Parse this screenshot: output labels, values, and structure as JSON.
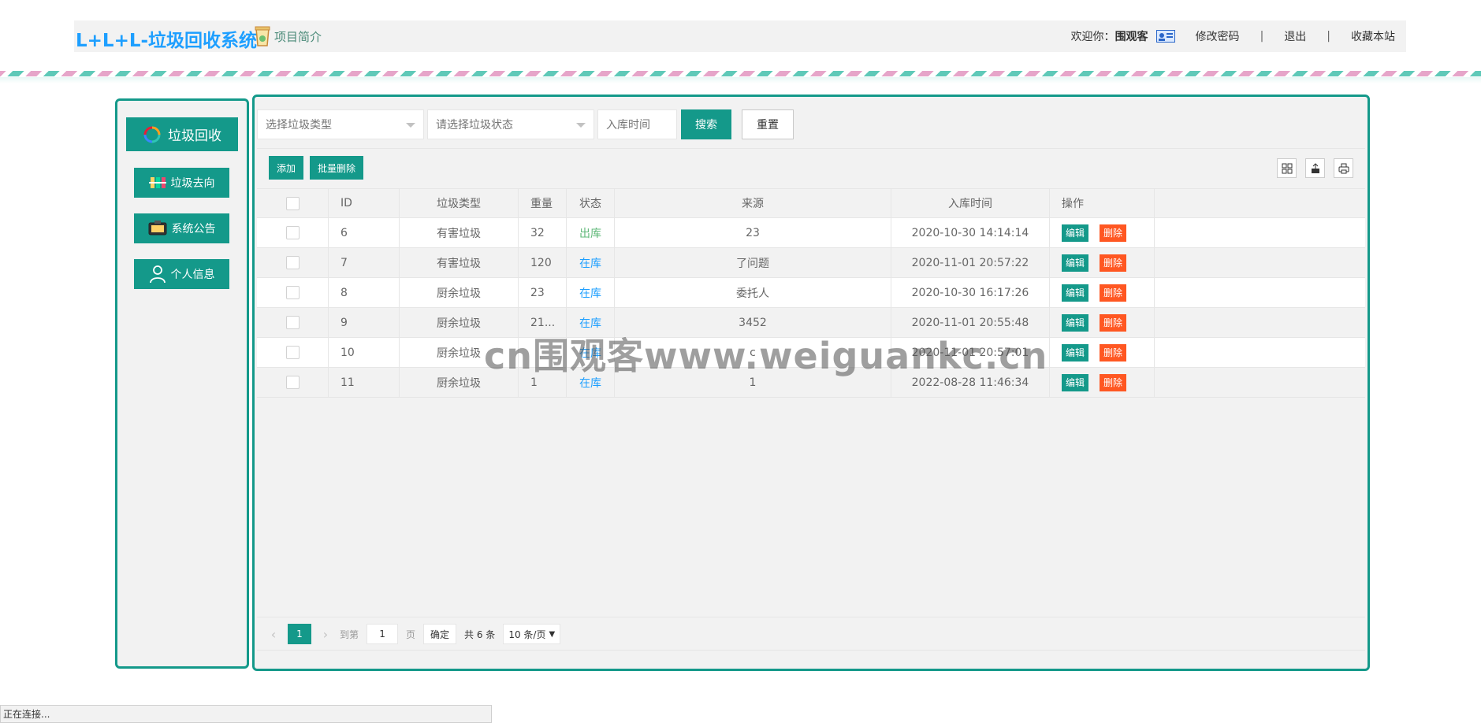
{
  "header": {
    "brand": "L+L+L-垃圾回收系统",
    "intro_label": "项目简介",
    "welcome_prefix": "欢迎你：",
    "username": "围观客",
    "change_password": "修改密码",
    "logout": "退出",
    "bookmark": "收藏本站",
    "separator": "|"
  },
  "sidebar": {
    "head_label": "垃圾回收",
    "items": [
      {
        "label": "垃圾去向",
        "icon": "sorting-bins-icon"
      },
      {
        "label": "系统公告",
        "icon": "announcement-icon"
      },
      {
        "label": "个人信息",
        "icon": "user-icon"
      }
    ]
  },
  "filters": {
    "type_placeholder": "选择垃圾类型",
    "status_placeholder": "请选择垃圾状态",
    "date_placeholder": "入库时间",
    "search_label": "搜索",
    "reset_label": "重置"
  },
  "toolbar": {
    "add_label": "添加",
    "batch_delete_label": "批量删除",
    "tools": [
      "columns-icon",
      "export-icon",
      "print-icon"
    ]
  },
  "table": {
    "columns": [
      "ID",
      "垃圾类型",
      "重量",
      "状态",
      "来源",
      "入库时间",
      "操作"
    ],
    "rows": [
      {
        "id": "6",
        "type": "有害垃圾",
        "weight": "32",
        "status": "出库",
        "source": "23",
        "time": "2020-10-30 14:14:14"
      },
      {
        "id": "7",
        "type": "有害垃圾",
        "weight": "120",
        "status": "在库",
        "source": "了问题",
        "time": "2020-11-01 20:57:22"
      },
      {
        "id": "8",
        "type": "厨余垃圾",
        "weight": "23",
        "status": "在库",
        "source": "委托人",
        "time": "2020-10-30 16:17:26"
      },
      {
        "id": "9",
        "type": "厨余垃圾",
        "weight": "21...",
        "status": "在库",
        "source": "3452",
        "time": "2020-11-01 20:55:48"
      },
      {
        "id": "10",
        "type": "厨余垃圾",
        "weight": "",
        "status": "在库",
        "source": "c",
        "time": "2020-11-01 20:57:01"
      },
      {
        "id": "11",
        "type": "厨余垃圾",
        "weight": "1",
        "status": "在库",
        "source": "1",
        "time": "2022-08-28 11:46:34"
      }
    ],
    "edit_label": "编辑",
    "delete_label": "删除"
  },
  "pager": {
    "current": "1",
    "goto_label": "到第",
    "goto_value": "1",
    "page_unit": "页",
    "confirm_label": "确定",
    "total_label": "共 6 条",
    "page_size": "10 条/页"
  },
  "watermark": "cn围观客www.weiguankc.cn",
  "statusbar": "正在连接...",
  "colors": {
    "primary": "#14998a",
    "brand": "#1e9fff",
    "danger": "#ff5722",
    "status_out": "#5fb878",
    "status_in": "#1e9fff"
  }
}
